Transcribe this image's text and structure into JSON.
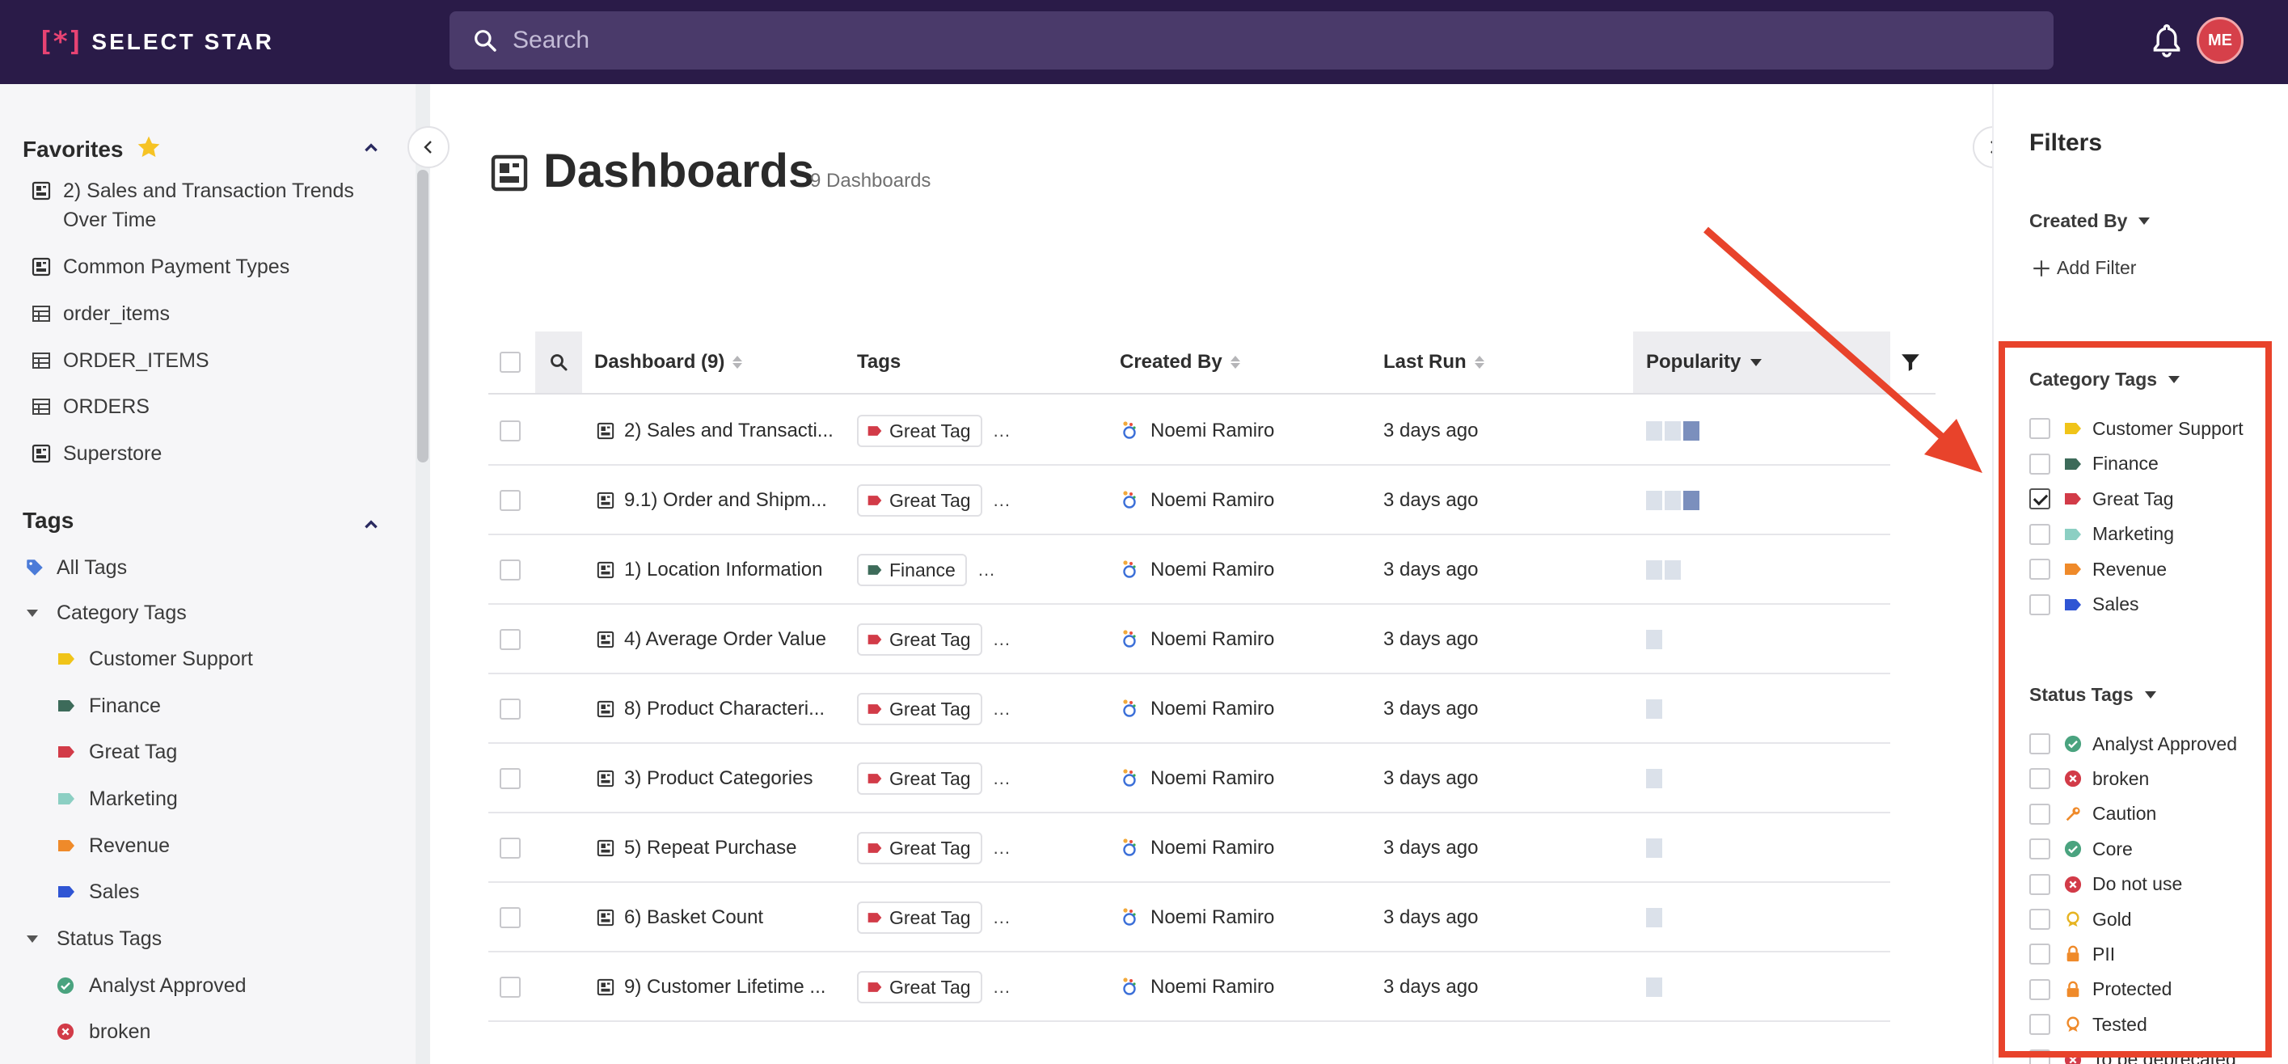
{
  "app": {
    "logo_mark": "[*]",
    "logo_text": "SELECT STAR"
  },
  "topbar": {
    "search_placeholder": "Search",
    "avatar_initials": "ME"
  },
  "sidebar": {
    "favorites_title": "Favorites",
    "favorites": [
      {
        "label": "2) Sales and Transaction Trends Over Time",
        "icon": "dashboard-icon"
      },
      {
        "label": "Common Payment Types",
        "icon": "dashboard-icon"
      },
      {
        "label": "order_items",
        "icon": "table-icon"
      },
      {
        "label": "ORDER_ITEMS",
        "icon": "table-icon"
      },
      {
        "label": "ORDERS",
        "icon": "table-icon"
      },
      {
        "label": "Superstore",
        "icon": "dashboard-icon"
      }
    ],
    "tags_title": "Tags",
    "all_tags": "All Tags",
    "category_group": "Category Tags",
    "category_tags": [
      {
        "label": "Customer Support",
        "color": "#f0c419"
      },
      {
        "label": "Finance",
        "color": "#3d6b5a"
      },
      {
        "label": "Great Tag",
        "color": "#d23b48"
      },
      {
        "label": "Marketing",
        "color": "#8ccfc3"
      },
      {
        "label": "Revenue",
        "color": "#ef8a2a"
      },
      {
        "label": "Sales",
        "color": "#2f55d4"
      }
    ],
    "status_group": "Status Tags",
    "status_tags": [
      {
        "label": "Analyst Approved",
        "icon": "check-circle-icon",
        "color": "#4aa37f"
      },
      {
        "label": "broken",
        "icon": "x-circle-icon",
        "color": "#d23b48"
      }
    ]
  },
  "main": {
    "title": "Dashboards",
    "count": "9 Dashboards",
    "columns": {
      "dashboard": "Dashboard (9)",
      "tags": "Tags",
      "created_by": "Created By",
      "last_run": "Last Run",
      "popularity": "Popularity"
    },
    "rows": [
      {
        "name": "2) Sales and Transacti...",
        "tag": "Great Tag",
        "tag_color": "#d23b48",
        "more": "...",
        "owner": "Noemi Ramiro",
        "last_run": "3 days ago",
        "popularity": 3
      },
      {
        "name": "9.1) Order and Shipm...",
        "tag": "Great Tag",
        "tag_color": "#d23b48",
        "more": "...",
        "owner": "Noemi Ramiro",
        "last_run": "3 days ago",
        "popularity": 3
      },
      {
        "name": "1) Location Information",
        "tag": "Finance",
        "tag_color": "#3d6b5a",
        "more": "...",
        "owner": "Noemi Ramiro",
        "last_run": "3 days ago",
        "popularity": 2
      },
      {
        "name": "4) Average Order Value",
        "tag": "Great Tag",
        "tag_color": "#d23b48",
        "more": "...",
        "owner": "Noemi Ramiro",
        "last_run": "3 days ago",
        "popularity": 1
      },
      {
        "name": "8) Product Characteri...",
        "tag": "Great Tag",
        "tag_color": "#d23b48",
        "more": "...",
        "owner": "Noemi Ramiro",
        "last_run": "3 days ago",
        "popularity": 1
      },
      {
        "name": "3) Product Categories",
        "tag": "Great Tag",
        "tag_color": "#d23b48",
        "more": "...",
        "owner": "Noemi Ramiro",
        "last_run": "3 days ago",
        "popularity": 1
      },
      {
        "name": "5) Repeat Purchase",
        "tag": "Great Tag",
        "tag_color": "#d23b48",
        "more": "...",
        "owner": "Noemi Ramiro",
        "last_run": "3 days ago",
        "popularity": 1
      },
      {
        "name": "6) Basket Count",
        "tag": "Great Tag",
        "tag_color": "#d23b48",
        "more": "...",
        "owner": "Noemi Ramiro",
        "last_run": "3 days ago",
        "popularity": 1
      },
      {
        "name": "9) Customer Lifetime ...",
        "tag": "Great Tag",
        "tag_color": "#d23b48",
        "more": "...",
        "owner": "Noemi Ramiro",
        "last_run": "3 days ago",
        "popularity": 1
      }
    ]
  },
  "filters": {
    "title": "Filters",
    "created_by": "Created By",
    "add_filter": "Add Filter",
    "category_tags_label": "Category Tags",
    "category_options": [
      {
        "label": "Customer Support",
        "color": "#f0c419",
        "checked": false
      },
      {
        "label": "Finance",
        "color": "#3d6b5a",
        "checked": false
      },
      {
        "label": "Great Tag",
        "color": "#d23b48",
        "checked": true
      },
      {
        "label": "Marketing",
        "color": "#8ccfc3",
        "checked": false
      },
      {
        "label": "Revenue",
        "color": "#ef8a2a",
        "checked": false
      },
      {
        "label": "Sales",
        "color": "#2f55d4",
        "checked": false
      }
    ],
    "status_tags_label": "Status Tags",
    "status_options": [
      {
        "label": "Analyst Approved",
        "icon": "check-circle-icon",
        "color": "#4aa37f"
      },
      {
        "label": "broken",
        "icon": "x-circle-icon",
        "color": "#d23b48"
      },
      {
        "label": "Caution",
        "icon": "wrench-icon",
        "color": "#ef8a2a"
      },
      {
        "label": "Core",
        "icon": "check-circle-icon",
        "color": "#4aa37f"
      },
      {
        "label": "Do not use",
        "icon": "x-circle-icon",
        "color": "#d23b48"
      },
      {
        "label": "Gold",
        "icon": "medal-icon",
        "color": "#e6b422"
      },
      {
        "label": "PII",
        "icon": "lock-icon",
        "color": "#ef8a2a"
      },
      {
        "label": "Protected",
        "icon": "lock-icon",
        "color": "#ef8a2a"
      },
      {
        "label": "Tested",
        "icon": "medal-icon",
        "color": "#ef8a2a"
      },
      {
        "label": "To be deprecated",
        "icon": "x-circle-icon",
        "color": "#d23b48"
      }
    ]
  },
  "annotation": {
    "color": "#e8432b"
  }
}
